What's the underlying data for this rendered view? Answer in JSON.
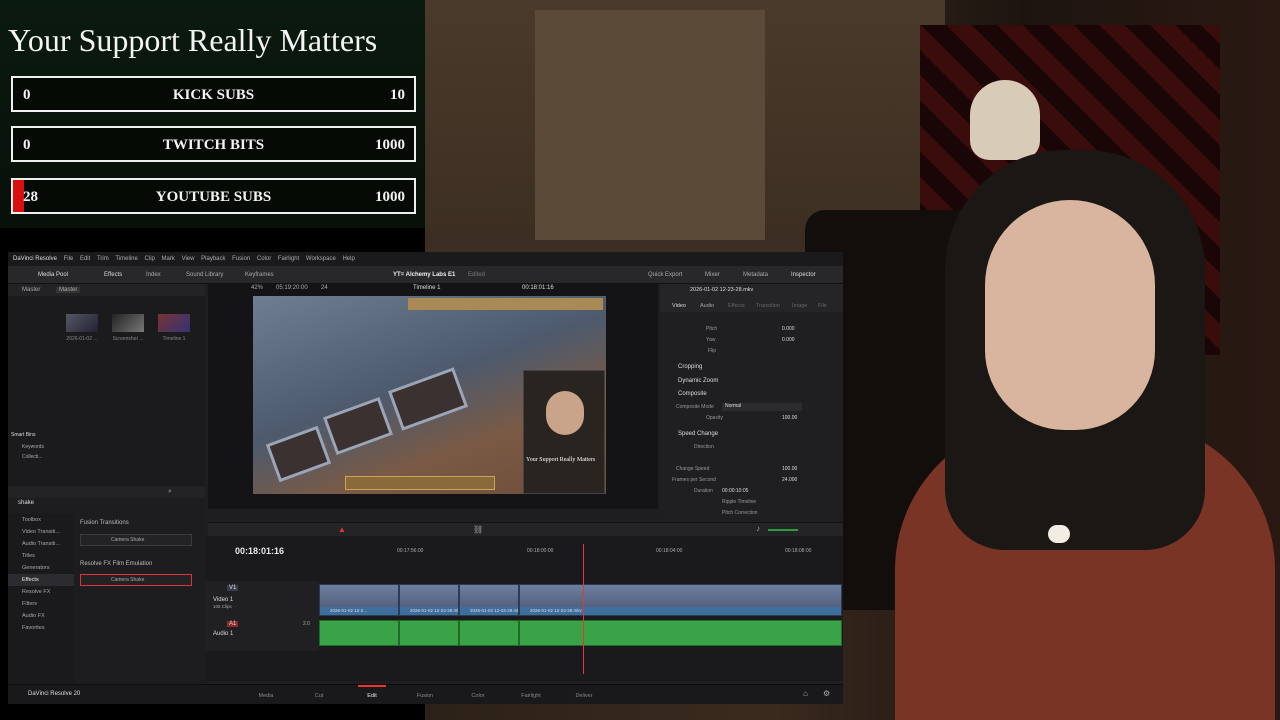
{
  "support": {
    "title": "Your Support Really Matters",
    "goals": [
      {
        "current": "0",
        "label": "KICK SUBS",
        "max": "10",
        "progress": 0
      },
      {
        "current": "0",
        "label": "TWITCH BITS",
        "max": "1000",
        "progress": 0
      },
      {
        "current": "28",
        "label": "YOUTUBE SUBS",
        "max": "1000",
        "progress": 0.028
      }
    ]
  },
  "resolve": {
    "app_title": "DaVinci Resolve",
    "menu": [
      "File",
      "Edit",
      "Trim",
      "Timeline",
      "Clip",
      "Mark",
      "View",
      "Playback",
      "Fusion",
      "Color",
      "Fairlight",
      "Workspace",
      "Help"
    ],
    "toolbar": {
      "media_pool": "Media Pool",
      "effects": "Effects",
      "index": "Index",
      "sound_library": "Sound Library",
      "keyframes": "Keyframes",
      "project": "YT= Alchemy Labs E1",
      "edited": "Edited",
      "quick_export": "Quick Export",
      "mixer": "Mixer",
      "metadata": "Metadata",
      "inspector": "Inspector"
    },
    "pool": {
      "master_tab": "Master",
      "master_bin": "Master",
      "clips": [
        "2026-01-02 ...",
        "Screenshot ...",
        "Timeline 1"
      ],
      "smart_bins": "Smart Bins",
      "keywords": "Keywords",
      "collections": "Collecti..."
    },
    "viewer": {
      "zoom": "42%",
      "source_tc": "05:19:20:00",
      "fps": "24",
      "timeline_name": "Timeline 1",
      "record_tc": "00:18:01:16",
      "clip_name": "2026-01-02 12-23-28.mkv"
    },
    "effects": {
      "search": "shake",
      "tree": [
        "Toolbox",
        "Video Transiti...",
        "Audio Transiti...",
        "Titles",
        "Generators",
        "Effects",
        "Resolve FX",
        "Filters",
        "Audio FX",
        "Favorites"
      ],
      "group1": "Fusion Transitions",
      "item1": "Camera Shake",
      "group2": "Resolve FX Film Emulation",
      "item2": "Camera Shake"
    },
    "inspector": {
      "tabs": [
        "Video",
        "Audio",
        "Effects",
        "Transition",
        "Image",
        "File"
      ],
      "pitch_label": "Pitch",
      "pitch_value": "0.000",
      "yaw_label": "Yaw",
      "yaw_value": "0.000",
      "flip_label": "Flip",
      "cropping": "Cropping",
      "dynamic_zoom": "Dynamic Zoom",
      "composite": "Composite",
      "composite_mode_label": "Composite Mode",
      "composite_mode_value": "Normal",
      "opacity_label": "Opacity",
      "opacity_value": "100.00",
      "speed_change": "Speed Change",
      "direction_label": "Direction",
      "change_speed_label": "Change Speed",
      "change_speed_value": "100.00",
      "fps_label": "Frames per Second",
      "fps_value": "24.000",
      "duration_label": "Duration",
      "duration_value": "00:00:10:05",
      "ripple": "Ripple Timeline",
      "pitch_correction": "Pitch Correction"
    },
    "timeline": {
      "timecode": "00:18:01:16",
      "ruler": [
        "00:17:56:00",
        "00:18:00:00",
        "00:18:04:00",
        "00:18:08:00"
      ],
      "v1_label": "V1",
      "video_track": "Video 1",
      "clip_count": "105 Clips",
      "a1_label": "A1",
      "audio_track": "Audio 1",
      "audio_level": "2.0",
      "clip_name_short": "2026-01-02 12-2...",
      "clip_name_mid": "2026-01-02 12-23-28.mkv",
      "clip_name": "2026-01-02 12-23-28.mkv"
    },
    "pages": [
      "Media",
      "Cut",
      "Edit",
      "Fusion",
      "Color",
      "Fairlight",
      "Deliver"
    ],
    "version": "DaVinci Resolve 20"
  },
  "colors": {
    "goal_fill": "#d81010",
    "audio_clip": "#3aa247",
    "video_clip": "#3e6e9c",
    "playhead": "#e33333"
  }
}
